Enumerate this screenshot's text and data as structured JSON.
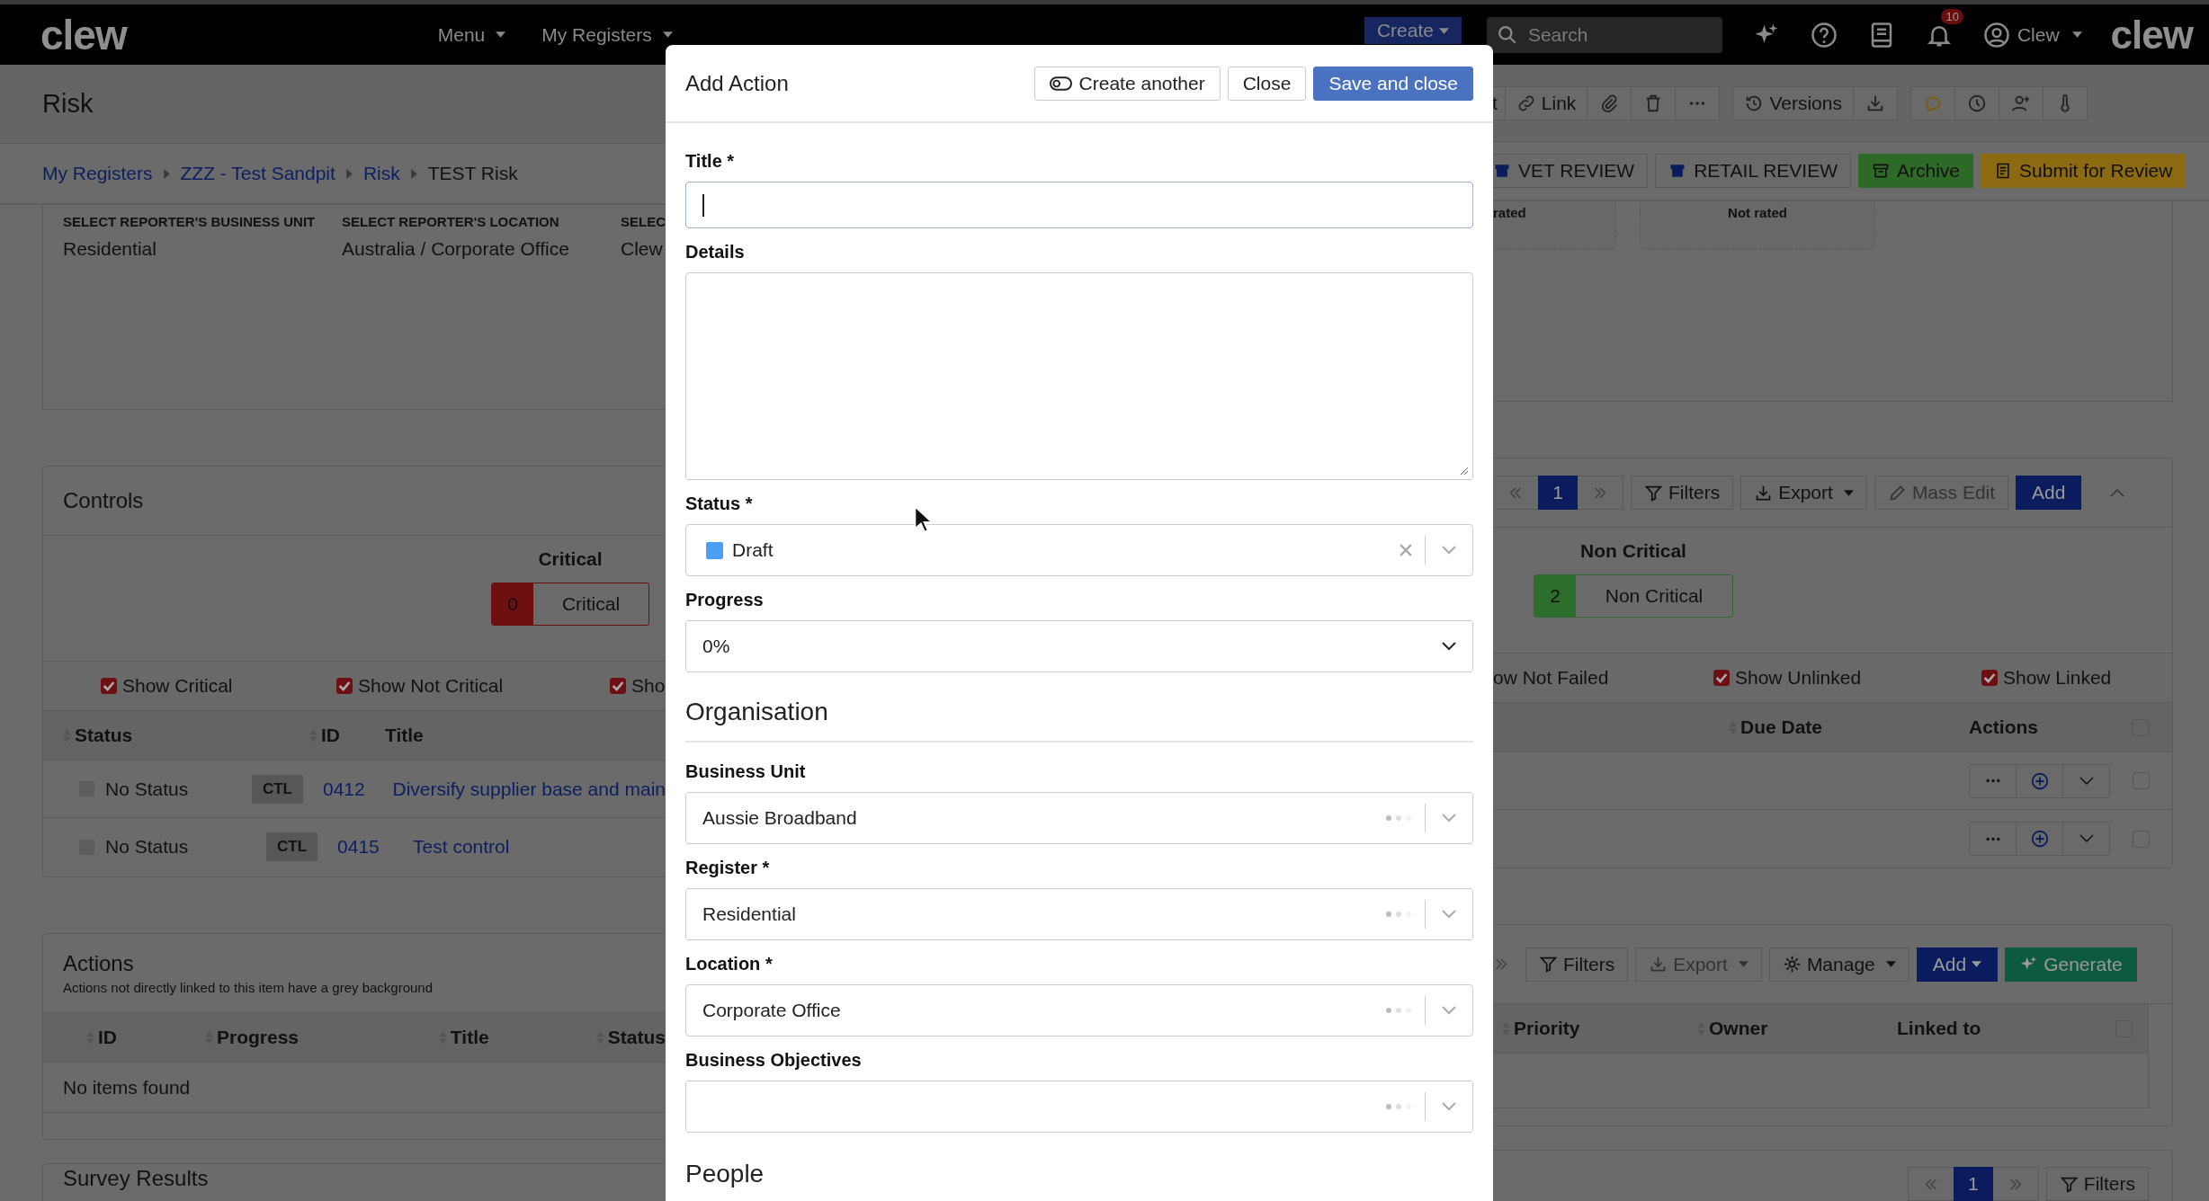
{
  "top_nav": {
    "logo": "clew",
    "menus": [
      "Menu",
      "My Registers"
    ],
    "create_button": "Create",
    "search": {
      "placeholder": "Search"
    },
    "notification_count": "10",
    "user": "Clew",
    "brand": "clew"
  },
  "page": {
    "title": "Risk",
    "toolbar_labels": [
      "t",
      "Link",
      "Versions"
    ]
  },
  "breadcrumb": [
    "My Registers",
    "ZZZ - Test Sandpit",
    "Risk",
    "TEST Risk"
  ],
  "workflow_buttons": [
    {
      "label": "VET REVIEW",
      "kind": "plain"
    },
    {
      "label": "RETAIL REVIEW",
      "kind": "plain"
    },
    {
      "label": "Archive",
      "kind": "success"
    },
    {
      "label": "Submit for Review",
      "kind": "warning"
    }
  ],
  "reporter_fields": [
    {
      "label": "SELECT REPORTER'S BUSINESS UNIT",
      "value": "Residential"
    },
    {
      "label": "SELECT REPORTER'S LOCATION",
      "value": "Australia / Corporate Office"
    },
    {
      "label": "SELEC",
      "value": "Clew"
    }
  ],
  "ratings": [
    "rated",
    "Not rated"
  ],
  "controls": {
    "title": "Controls",
    "page": "1",
    "buttons": [
      "Filters",
      "Export",
      "Mass Edit",
      "Add"
    ],
    "groups": [
      {
        "heading": "Critical",
        "count": "0",
        "label": "Critical",
        "kind": "critical"
      },
      {
        "heading": "Non Critical",
        "count": "2",
        "label": "Non Critical",
        "kind": "non_critical"
      }
    ],
    "filters_left": [
      {
        "label": "Show Critical",
        "checked": true
      },
      {
        "label": "Show Not Critical",
        "checked": true
      },
      {
        "label": "Sho",
        "checked": true
      }
    ],
    "cut_filter_label": "ow Not Failed",
    "filters_right": [
      {
        "label": "Show Unlinked",
        "checked": true
      },
      {
        "label": "Show Linked",
        "checked": true
      }
    ],
    "columns": [
      "Status",
      "ID",
      "Title",
      "Due Date",
      "Actions"
    ],
    "select_all_checked": false,
    "rows": [
      {
        "status": "No Status",
        "type": "CTL",
        "id": "0412",
        "title": "Diversify supplier base and main",
        "checked": false
      },
      {
        "status": "No Status",
        "type": "CTL",
        "id": "0415",
        "title": "Test control",
        "checked": false
      }
    ]
  },
  "actions": {
    "title": "Actions",
    "subtitle": "Actions not directly linked to this item have a grey background",
    "buttons": [
      "Filters",
      "Export",
      "Manage",
      "Add",
      "Generate"
    ],
    "columns_left": [
      "ID",
      "Progress",
      "Title",
      "Status"
    ],
    "columns_right": [
      "Priority",
      "Owner",
      "Linked to"
    ],
    "select_all_checked": false,
    "empty": "No items found"
  },
  "survey": {
    "title": "Survey Results",
    "page": "1",
    "buttons": [
      "Filters"
    ]
  },
  "modal": {
    "title": "Add Action",
    "create_another": "Create another",
    "close": "Close",
    "save": "Save and close",
    "fields": [
      {
        "label": "Title *",
        "kind": "text"
      },
      {
        "label": "Details",
        "kind": "textarea"
      },
      {
        "label": "Status *",
        "kind": "select",
        "value": "Draft",
        "color": "#4a9ff5"
      },
      {
        "label": "Progress",
        "kind": "dropdown",
        "value": "0%"
      }
    ],
    "organisation": {
      "heading": "Organisation",
      "fields": [
        {
          "label": "Business Unit",
          "kind": "lookup",
          "value": "Aussie Broadband"
        },
        {
          "label": "Register *",
          "kind": "lookup",
          "value": "Residential"
        },
        {
          "label": "Location *",
          "kind": "lookup",
          "value": "Corporate Office"
        },
        {
          "label": "Business Objectives",
          "kind": "lookup"
        }
      ]
    },
    "next_heading": "People"
  }
}
